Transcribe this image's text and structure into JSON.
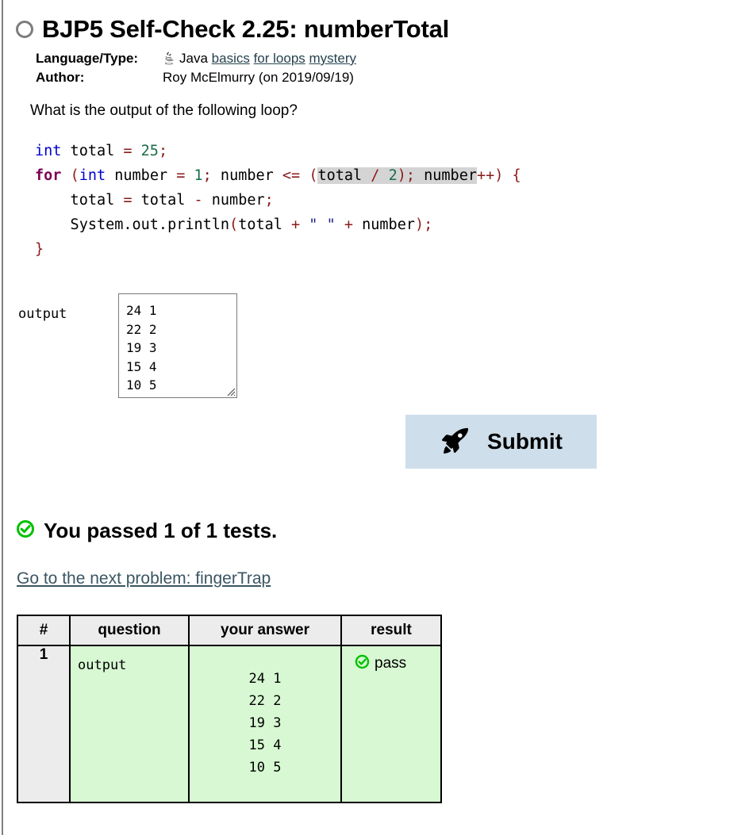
{
  "page": {
    "status_icon": "circle-outline-icon",
    "title": "BJP5 Self-Check 2.25: numberTotal"
  },
  "meta": {
    "language_label": "Language/Type:",
    "language_icon": "java-cup-icon",
    "language_value": "Java",
    "tags": [
      "basics",
      "for loops",
      "mystery"
    ],
    "author_label": "Author:",
    "author_value": "Roy McElmurry (on 2019/09/19)"
  },
  "prompt": {
    "question": "What is the output of the following loop?"
  },
  "code": {
    "lines": [
      [
        {
          "t": "int",
          "c": "k-type"
        },
        {
          "t": " total ",
          "c": ""
        },
        {
          "t": "=",
          "c": "k-op"
        },
        {
          "t": " ",
          "c": ""
        },
        {
          "t": "25",
          "c": "k-num"
        },
        {
          "t": ";",
          "c": "k-punct"
        }
      ],
      [
        {
          "t": "for",
          "c": "k-ctrl"
        },
        {
          "t": " ",
          "c": ""
        },
        {
          "t": "(",
          "c": "k-punct"
        },
        {
          "t": "int",
          "c": "k-type"
        },
        {
          "t": " number ",
          "c": ""
        },
        {
          "t": "=",
          "c": "k-op"
        },
        {
          "t": " ",
          "c": ""
        },
        {
          "t": "1",
          "c": "k-num"
        },
        {
          "t": ";",
          "c": "k-punct"
        },
        {
          "t": " number ",
          "c": ""
        },
        {
          "t": "<=",
          "c": "k-op"
        },
        {
          "t": " ",
          "c": ""
        },
        {
          "t": "(",
          "c": "k-punct"
        },
        {
          "t": "total ",
          "c": "sel"
        },
        {
          "t": "/",
          "c": "k-op sel"
        },
        {
          "t": " ",
          "c": "sel"
        },
        {
          "t": "2",
          "c": "k-num sel"
        },
        {
          "t": ")",
          "c": "k-punct sel"
        },
        {
          "t": ";",
          "c": "k-punct sel"
        },
        {
          "t": " number",
          "c": "sel"
        },
        {
          "t": "++",
          "c": "k-op"
        },
        {
          "t": ")",
          "c": "k-punct"
        },
        {
          "t": " ",
          "c": ""
        },
        {
          "t": "{",
          "c": "k-punct"
        }
      ],
      [
        {
          "t": "    total ",
          "c": ""
        },
        {
          "t": "=",
          "c": "k-op"
        },
        {
          "t": " total ",
          "c": ""
        },
        {
          "t": "-",
          "c": "k-op"
        },
        {
          "t": " number",
          "c": ""
        },
        {
          "t": ";",
          "c": "k-punct"
        }
      ],
      [
        {
          "t": "    System.out.println",
          "c": ""
        },
        {
          "t": "(",
          "c": "k-punct"
        },
        {
          "t": "total ",
          "c": ""
        },
        {
          "t": "+",
          "c": "k-op"
        },
        {
          "t": " ",
          "c": ""
        },
        {
          "t": "\" \"",
          "c": "k-str"
        },
        {
          "t": " ",
          "c": ""
        },
        {
          "t": "+",
          "c": "k-op"
        },
        {
          "t": " number",
          "c": ""
        },
        {
          "t": ")",
          "c": "k-punct"
        },
        {
          "t": ";",
          "c": "k-punct"
        }
      ],
      [
        {
          "t": "}",
          "c": "k-punct"
        }
      ]
    ]
  },
  "answer": {
    "label": "output",
    "value": "24 1\n22 2\n19 3\n15 4\n10 5",
    "placeholder": "",
    "resize_handle_icon": "resize-grip-icon"
  },
  "submit": {
    "icon": "rocket-icon",
    "label": "Submit",
    "background": "#cfdeeb"
  },
  "result": {
    "icon": "check-circle-icon",
    "message": "You passed 1 of 1 tests.",
    "next_link": "Go to the next problem: fingerTrap",
    "accent_green": "#00c000",
    "row_green": "#d7f8d2"
  },
  "results_table": {
    "headers": [
      "#",
      "question",
      "your answer",
      "result"
    ],
    "rows": [
      {
        "num": "1",
        "question": "output",
        "your_answer": "24 1\n22 2\n19 3\n15 4\n10 5",
        "result_icon": "check-circle-icon",
        "result": "pass"
      }
    ]
  }
}
